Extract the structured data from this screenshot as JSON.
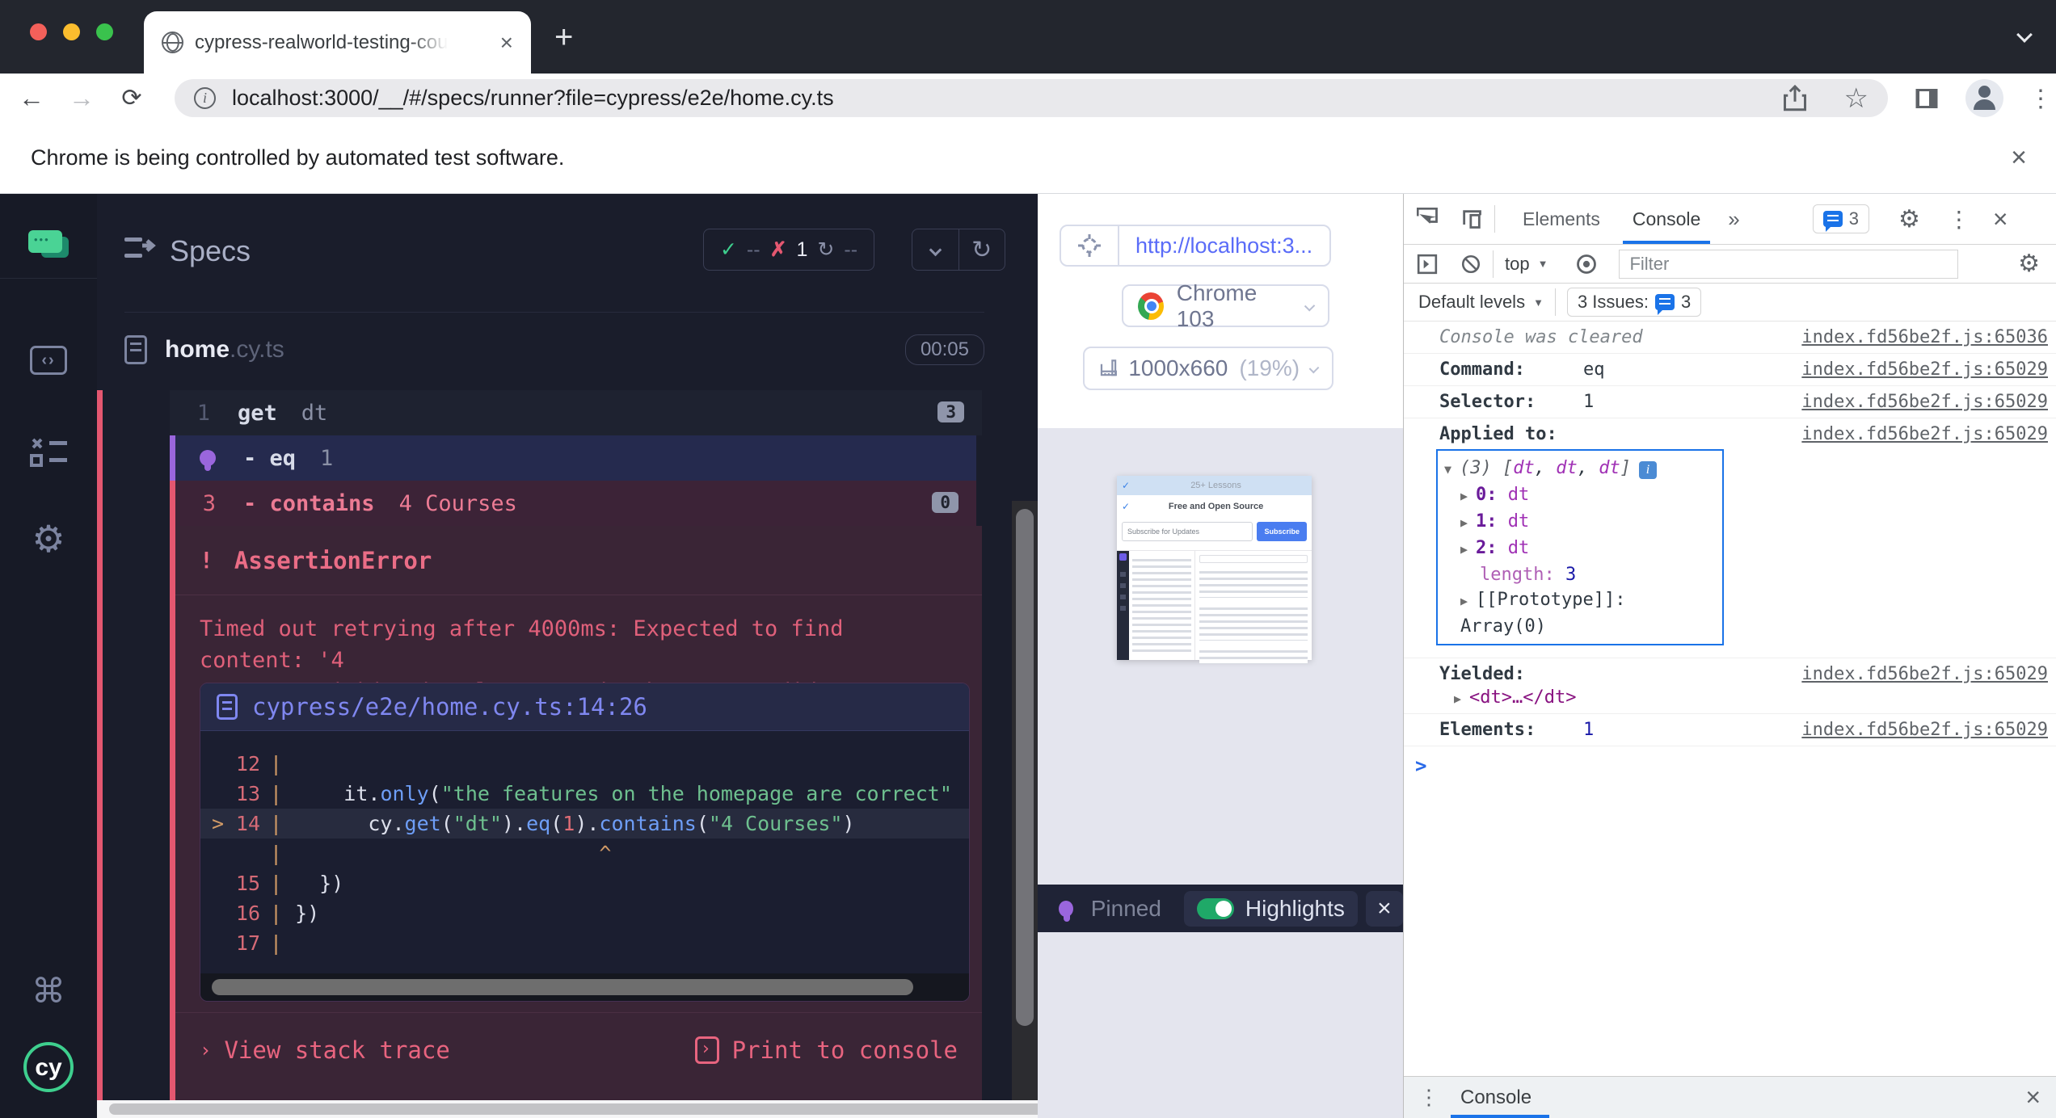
{
  "icons": {
    "check": "✓",
    "cross": "✗",
    "restart": "↻",
    "close": "×",
    "plus": "+",
    "more_tabs": "»",
    "dots_v": "⋮",
    "command": "⌘",
    "gear": "⚙",
    "star": "☆",
    "chevron_r": "›",
    "arrow_d": "▼",
    "arrow_r": "▶",
    "prompt": ">",
    "info": "i",
    "back": "←",
    "forward": "→",
    "reload": "⟳",
    "bang": "!"
  },
  "browser": {
    "tab_title": "cypress-realworld-testing-cou",
    "url": "localhost:3000/__/#/specs/runner?file=cypress/e2e/home.cy.ts",
    "infobar_text": "Chrome is being controlled by automated test software."
  },
  "specs": {
    "title": "Specs",
    "stats": {
      "passed": "--",
      "failed": "1",
      "skipped": "--"
    },
    "file": {
      "name": "home",
      "ext": ".cy.ts",
      "duration": "00:05"
    },
    "commands": {
      "c1": {
        "num": "1",
        "name": "get",
        "arg": "dt",
        "badge": "3"
      },
      "c2": {
        "name": "- eq",
        "arg": "1"
      },
      "c3": {
        "num": "3",
        "name": "- contains",
        "arg": "4 Courses",
        "badge": "0"
      }
    },
    "error": {
      "title": "AssertionError",
      "line1": "Timed out retrying after 4000ms: Expected to find content: '4",
      "line2": "Courses' within the element: <dt> but never did.",
      "file_ref": "cypress/e2e/home.cy.ts:14:26",
      "code": {
        "marker": ">",
        "pipe": "|",
        "l12": "12",
        "l13": "13",
        "l14": "14",
        "l15": "15",
        "l16": "16",
        "l17": "17",
        "c13_a": "    it",
        "c13_b": ".",
        "c13_c": "only",
        "c13_d": "(",
        "c13_e": "\"the features on the homepage are correct\"",
        "c14_a": "      cy.",
        "c14_b": "get",
        "c14_c": "(",
        "c14_d": "\"dt\"",
        "c14_e": ").",
        "c14_f": "eq",
        "c14_g": "(",
        "c14_h": "1",
        "c14_i": ").",
        "c14_j": "contains",
        "c14_k": "(",
        "c14_l": "\"4 Courses\"",
        "c14_m": ")",
        "caret_line": "                         ^",
        "c15": "  })",
        "c16": "})"
      },
      "stack_btn": "View stack trace",
      "print_btn": "Print to console"
    }
  },
  "preview": {
    "url_text": "http://localhost:3...",
    "browser_name": "Chrome 103",
    "viewport": "1000x660",
    "zoom": "(19%)",
    "thumb": {
      "banner": "25+ Lessons",
      "feature": "Free and Open Source",
      "input_text": "Subscribe for Updates",
      "button": "Subscribe"
    },
    "pinned": {
      "label": "Pinned",
      "toggle": "Highlights"
    }
  },
  "devtools": {
    "tab_elements": "Elements",
    "tab_console": "Console",
    "msg_count": "3",
    "context": "top",
    "filter_placeholder": "Filter",
    "levels": "Default levels",
    "issues_label": "3 Issues:",
    "issues_count": "3",
    "rows": {
      "cleared": {
        "text": "Console was cleared",
        "link": "index.fd56be2f.js:65036"
      },
      "command": {
        "label": "Command:",
        "value": "eq",
        "link": "index.fd56be2f.js:65029"
      },
      "selector": {
        "label": "Selector:",
        "value": "1",
        "link": "index.fd56be2f.js:65029"
      },
      "applied": {
        "label": "Applied to:",
        "link": "index.fd56be2f.js:65029",
        "preview_open": "(3) [",
        "sep": ", ",
        "preview_close": "]",
        "item0": "dt",
        "item1": "dt",
        "item2": "dt",
        "k0": "0:",
        "v0": "dt",
        "k1": "1:",
        "v1": "dt",
        "k2": "2:",
        "v2": "dt",
        "klen": "length:",
        "vlen": "3",
        "kproto": "[[Prototype]]:",
        "vproto": "Array(0)"
      },
      "yielded": {
        "label": "Yielded:",
        "value": "<dt>…</dt>",
        "link": "index.fd56be2f.js:65029"
      },
      "elements": {
        "label": "Elements:",
        "value": "1",
        "link": "index.fd56be2f.js:65029"
      }
    },
    "drawer_title": "Console"
  }
}
